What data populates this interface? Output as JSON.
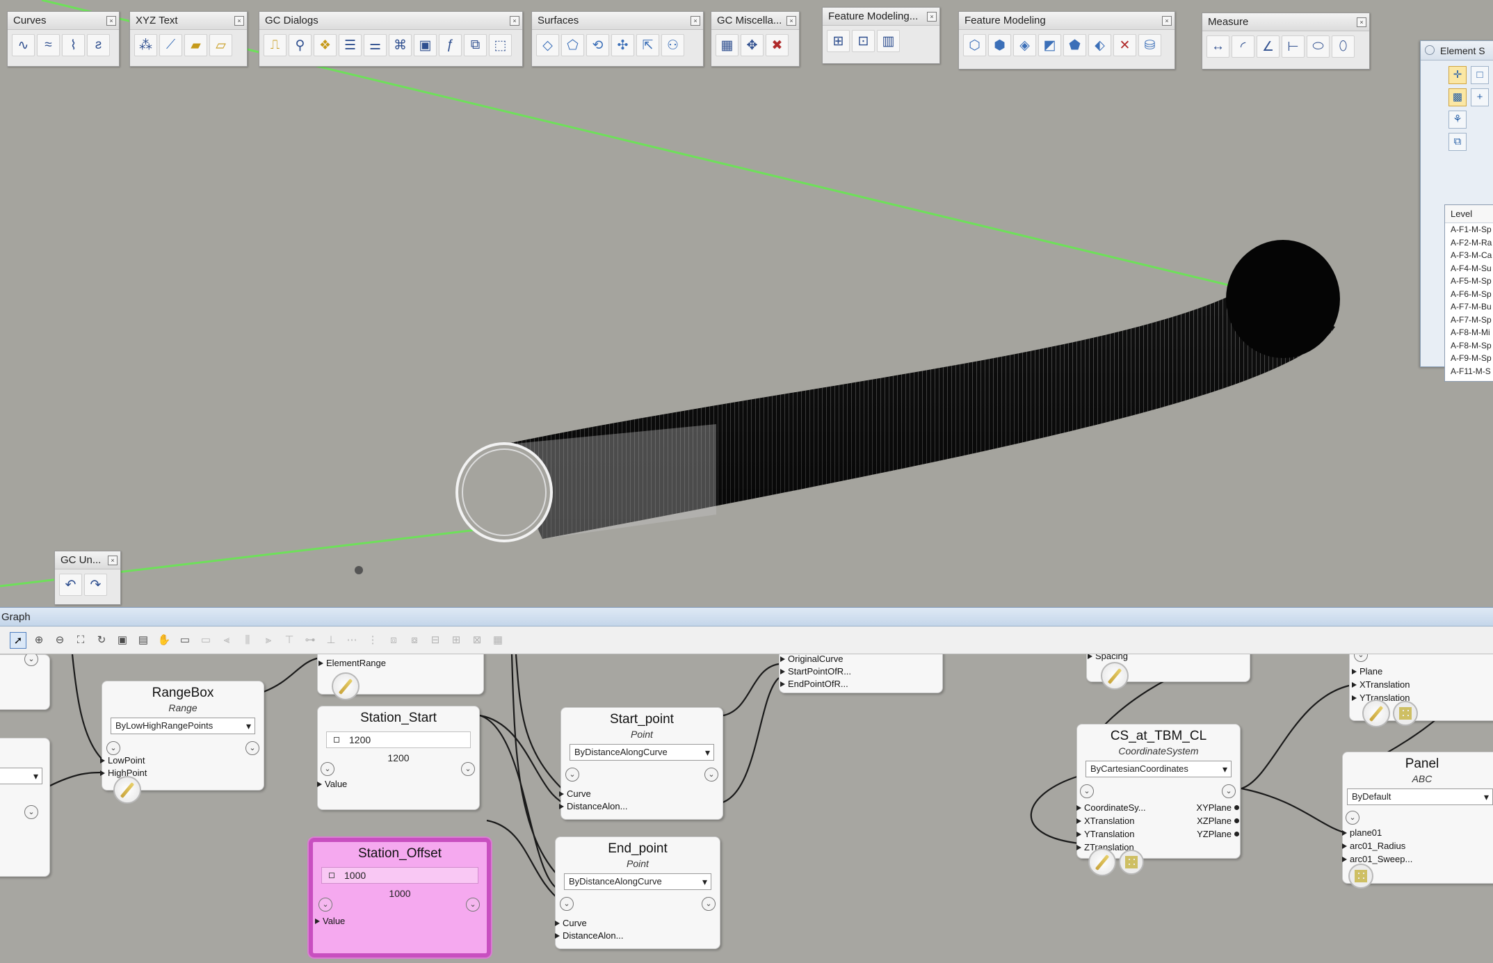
{
  "toolbars": [
    {
      "key": "curves",
      "title": "Curves"
    },
    {
      "key": "xyz_text",
      "title": "XYZ Text"
    },
    {
      "key": "gc_dialogs",
      "title": "GC Dialogs"
    },
    {
      "key": "surfaces",
      "title": "Surfaces"
    },
    {
      "key": "gc_misc",
      "title": "GC Miscella..."
    },
    {
      "key": "feature_modeling_1",
      "title": "Feature Modeling..."
    },
    {
      "key": "feature_modeling_2",
      "title": "Feature Modeling"
    },
    {
      "key": "measure",
      "title": "Measure"
    }
  ],
  "gc_undo": {
    "title": "GC Un..."
  },
  "element_panel": {
    "title": "Element S",
    "list_header": "Level",
    "levels": [
      "A-F1-M-Sp",
      "A-F2-M-Ra",
      "A-F3-M-Ca",
      "A-F4-M-Su",
      "A-F5-M-Sp",
      "A-F6-M-Sp",
      "A-F7-M-Bu",
      "A-F7-M-Sp",
      "A-F8-M-Mi",
      "A-F8-M-Sp",
      "A-F9-M-Sp",
      "A-F11-M-S"
    ]
  },
  "graph": {
    "title": "Graph",
    "nodes": {
      "element_range": {
        "port": "ElementRange"
      },
      "rangebox": {
        "title": "RangeBox",
        "type": "Range",
        "technique": "ByLowHighRangePoints",
        "inputs": [
          "LowPoint",
          "HighPoint"
        ]
      },
      "station_start": {
        "title": "Station_Start",
        "input_value": "1200",
        "value": "1200",
        "port": "Value"
      },
      "station_offset": {
        "title": "Station_Offset",
        "input_value": "1000",
        "value": "1000",
        "port": "Value"
      },
      "start_point": {
        "title": "Start_point",
        "type": "Point",
        "technique": "ByDistanceAlongCurve",
        "inputs": [
          "Curve",
          "DistanceAlon..."
        ]
      },
      "end_point": {
        "title": "End_point",
        "type": "Point",
        "technique": "ByDistanceAlongCurve",
        "inputs": [
          "Curve",
          "DistanceAlon..."
        ]
      },
      "curve_node": {
        "inputs": [
          "OriginalCurve",
          "StartPointOfR...",
          "EndPointOfR..."
        ]
      },
      "spacing_node": {
        "port": "Spacing"
      },
      "cs_at_tbm": {
        "title": "CS_at_TBM_CL",
        "type": "CoordinateSystem",
        "technique": "ByCartesianCoordinates",
        "inputs": [
          "CoordinateSy...",
          "XTranslation",
          "YTranslation",
          "ZTranslation"
        ],
        "outputs": [
          "XYPlane",
          "XZPlane",
          "YZPlane"
        ]
      },
      "plane_node": {
        "inputs": [
          "Plane",
          "XTranslation",
          "YTranslation"
        ]
      },
      "panel": {
        "title": "Panel",
        "type": "ABC",
        "technique": "ByDefault",
        "inputs": [
          "plane01",
          "arc01_Radius",
          "arc01_Sweep..."
        ]
      }
    }
  },
  "colors": {
    "viewport_bg": "#a5a49e",
    "guide_line": "#6ee05a",
    "highlight_node": "#f5a9ef"
  }
}
